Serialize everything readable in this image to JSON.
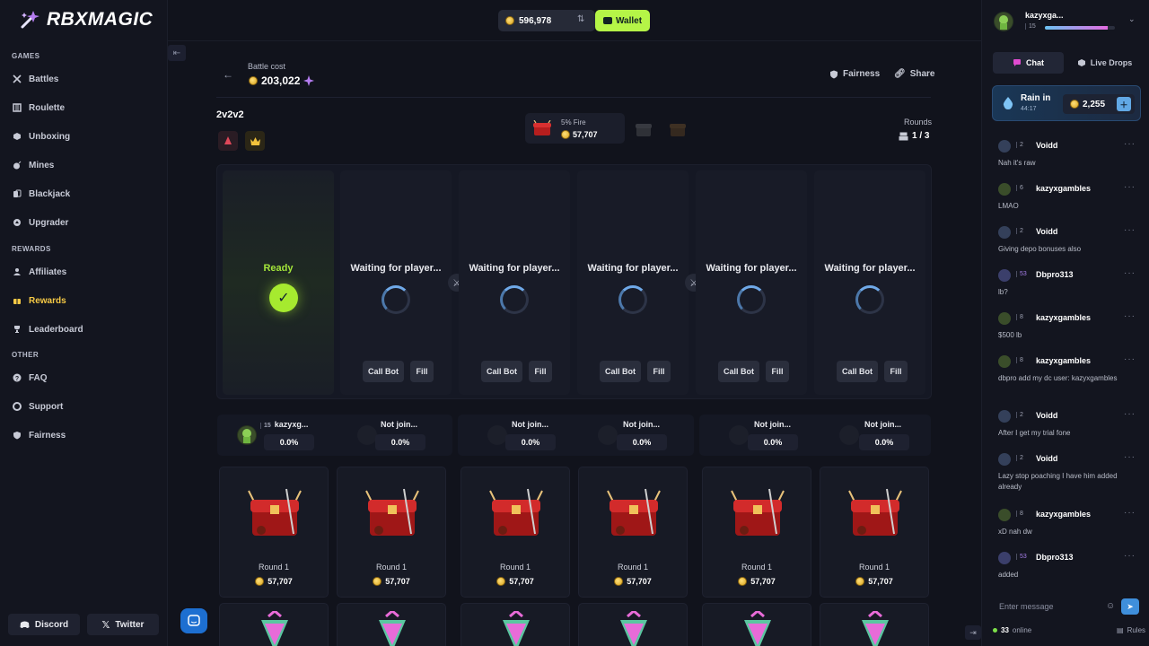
{
  "brand": {
    "name": "RBXMAGIC"
  },
  "sidebar": {
    "sections": [
      {
        "title": "GAMES",
        "items": [
          {
            "label": "Battles",
            "icon": "swords-icon"
          },
          {
            "label": "Roulette",
            "icon": "roulette-icon"
          },
          {
            "label": "Unboxing",
            "icon": "box-icon"
          },
          {
            "label": "Mines",
            "icon": "bomb-icon"
          },
          {
            "label": "Blackjack",
            "icon": "cards-icon"
          },
          {
            "label": "Upgrader",
            "icon": "upgrade-icon"
          }
        ]
      },
      {
        "title": "REWARDS",
        "items": [
          {
            "label": "Affiliates",
            "icon": "users-icon"
          },
          {
            "label": "Rewards",
            "icon": "gift-icon",
            "active": true
          },
          {
            "label": "Leaderboard",
            "icon": "trophy-icon"
          }
        ]
      },
      {
        "title": "OTHER",
        "items": [
          {
            "label": "FAQ",
            "icon": "question-icon"
          },
          {
            "label": "Support",
            "icon": "lifebuoy-icon"
          },
          {
            "label": "Fairness",
            "icon": "shield-icon"
          }
        ]
      }
    ],
    "discord_label": "Discord",
    "twitter_label": "Twitter"
  },
  "topbar": {
    "balance": "596,978",
    "wallet_label": "Wallet"
  },
  "battle": {
    "cost_label": "Battle cost",
    "cost_value": "203,022",
    "fairness_label": "Fairness",
    "share_label": "Share",
    "mode": "2v2v2",
    "current_case": {
      "name": "5% Fire",
      "price": "57,707"
    },
    "rounds_label": "Rounds",
    "rounds_value": "1 / 3",
    "slots": [
      {
        "status": "Ready",
        "ready": true
      },
      {
        "status": "Waiting for player...",
        "call_bot": "Call Bot",
        "fill": "Fill"
      },
      {
        "status": "Waiting for player...",
        "call_bot": "Call Bot",
        "fill": "Fill"
      },
      {
        "status": "Waiting for player...",
        "call_bot": "Call Bot",
        "fill": "Fill"
      },
      {
        "status": "Waiting for player...",
        "call_bot": "Call Bot",
        "fill": "Fill"
      },
      {
        "status": "Waiting for player...",
        "call_bot": "Call Bot",
        "fill": "Fill"
      }
    ],
    "players": [
      {
        "name": "kazyxg...",
        "level": "15",
        "pct": "0.0%"
      },
      {
        "name": "Not join...",
        "pct": "0.0%"
      },
      {
        "name": "Not join...",
        "pct": "0.0%"
      },
      {
        "name": "Not join...",
        "pct": "0.0%"
      },
      {
        "name": "Not join...",
        "pct": "0.0%"
      },
      {
        "name": "Not join...",
        "pct": "0.0%"
      }
    ],
    "round_cards": [
      {
        "label": "Round 1",
        "price": "57,707"
      },
      {
        "label": "Round 1",
        "price": "57,707"
      },
      {
        "label": "Round 1",
        "price": "57,707"
      },
      {
        "label": "Round 1",
        "price": "57,707"
      },
      {
        "label": "Round 1",
        "price": "57,707"
      },
      {
        "label": "Round 1",
        "price": "57,707"
      }
    ]
  },
  "chat": {
    "user": {
      "name": "kazyxga...",
      "level": "15",
      "xp_fraction": 0.9
    },
    "tabs": [
      {
        "label": "Chat",
        "active": true
      },
      {
        "label": "Live Drops"
      }
    ],
    "rain": {
      "label": "Rain in",
      "time": "44:17",
      "amount": "2,255"
    },
    "messages": [
      {
        "name": "Voidd",
        "level": "2",
        "text": "Nah it's raw"
      },
      {
        "name": "kazyxgambles",
        "level": "6",
        "text": "LMAO"
      },
      {
        "name": "Voidd",
        "level": "2",
        "text": "Giving depo bonuses also"
      },
      {
        "name": "Dbpro313",
        "level": "53",
        "vip": true,
        "text": "lb?"
      },
      {
        "name": "kazyxgambles",
        "level": "8",
        "text": "$500 lb"
      },
      {
        "name": "kazyxgambles",
        "level": "8",
        "text": "dbpro add my dc user: kazyxgambles"
      },
      {
        "name": "Voidd",
        "level": "2",
        "text": "After I get my trial fone"
      },
      {
        "name": "Voidd",
        "level": "2",
        "text": "Lazy stop poaching I have him added already"
      },
      {
        "name": "kazyxgambles",
        "level": "8",
        "text": "xD nah dw"
      },
      {
        "name": "Dbpro313",
        "level": "53",
        "vip": true,
        "text": "added"
      }
    ],
    "input_placeholder": "Enter message",
    "online_count": "33",
    "online_label": "online",
    "rules_label": "Rules"
  }
}
